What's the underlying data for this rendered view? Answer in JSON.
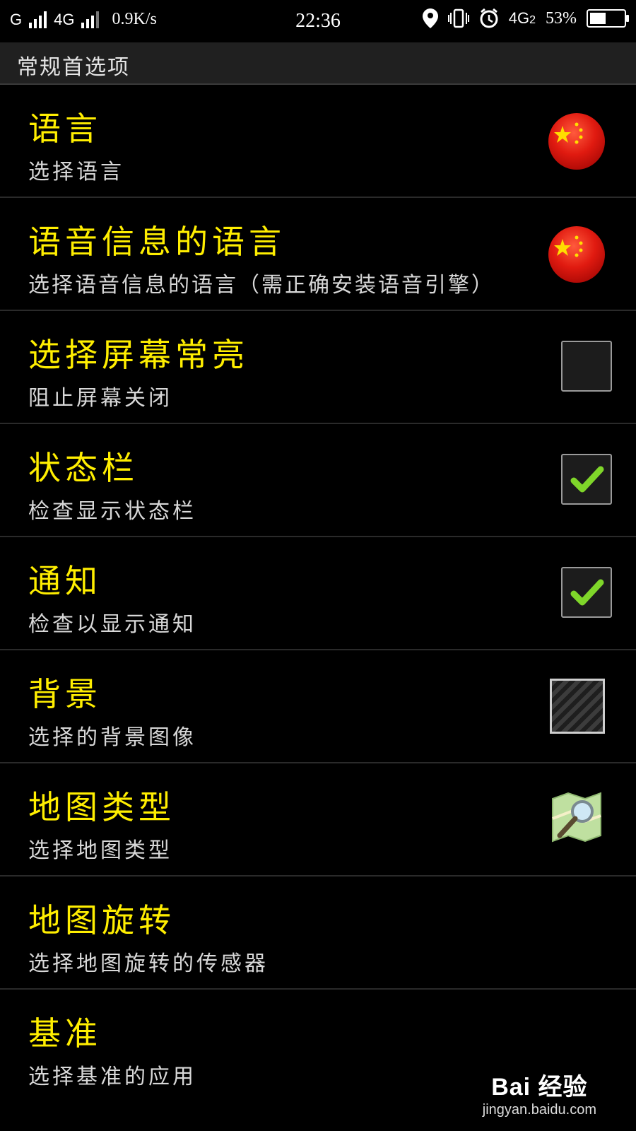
{
  "status_bar": {
    "carrier1": "G",
    "network2": "4G",
    "speed": "0.9K/s",
    "time": "22:36",
    "network3": "4G",
    "sim_slot": "2",
    "battery_percent": "53%",
    "battery_level": 0.53
  },
  "section": {
    "title": "常规首选项"
  },
  "items": [
    {
      "title": "语言",
      "subtitle": "选择语言",
      "control": "flag-icon"
    },
    {
      "title": "语音信息的语言",
      "subtitle": "选择语音信息的语言（需正确安装语音引擎）",
      "control": "flag-icon"
    },
    {
      "title": "选择屏幕常亮",
      "subtitle": "阻止屏幕关闭",
      "control": "checkbox",
      "checked": false
    },
    {
      "title": "状态栏",
      "subtitle": "检查显示状态栏",
      "control": "checkbox",
      "checked": true
    },
    {
      "title": "通知",
      "subtitle": "检查以显示通知",
      "control": "checkbox",
      "checked": true
    },
    {
      "title": "背景",
      "subtitle": "选择的背景图像",
      "control": "background-swatch"
    },
    {
      "title": "地图类型",
      "subtitle": "选择地图类型",
      "control": "map-search-icon"
    },
    {
      "title": "地图旋转",
      "subtitle": "选择地图旋转的传感器",
      "control": "none"
    },
    {
      "title": "基准",
      "subtitle": "选择基准的应用",
      "control": "none"
    }
  ],
  "watermark": {
    "logo": "Bai 经验",
    "url": "jingyan.baidu.com"
  },
  "colors": {
    "title": "#ffee00",
    "subtitle": "#d8d8d8",
    "background": "#000000",
    "check": "#7fd62a"
  }
}
